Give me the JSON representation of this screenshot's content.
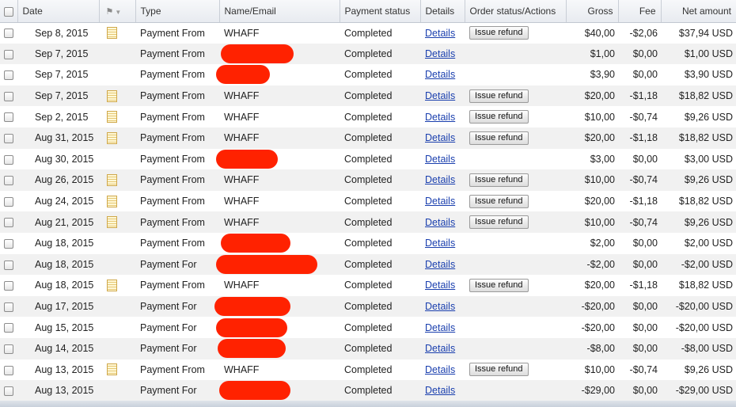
{
  "header": {
    "date": "Date",
    "type": "Type",
    "name_email": "Name/Email",
    "payment_status": "Payment status",
    "details": "Details",
    "order_status": "Order status/Actions",
    "gross": "Gross",
    "fee": "Fee",
    "net": "Net amount",
    "flag_icon": "flag-icon"
  },
  "rows": [
    {
      "date": "Sep 8, 2015",
      "note": true,
      "type": "Payment From",
      "name": "WHAFF",
      "redacted": false,
      "status": "Completed",
      "details": "Details",
      "action": "Issue refund",
      "gross": "$40,00",
      "fee": "-$2,06",
      "net": "$37,94 USD"
    },
    {
      "date": "Sep 7, 2015",
      "note": false,
      "type": "Payment From",
      "name": "",
      "redacted": true,
      "status": "Completed",
      "details": "Details",
      "action": "",
      "gross": "$1,00",
      "fee": "$0,00",
      "net": "$1,00 USD"
    },
    {
      "date": "Sep 7, 2015",
      "note": false,
      "type": "Payment From",
      "name": "",
      "redacted": true,
      "status": "Completed",
      "details": "Details",
      "action": "",
      "gross": "$3,90",
      "fee": "$0,00",
      "net": "$3,90 USD"
    },
    {
      "date": "Sep 7, 2015",
      "note": true,
      "type": "Payment From",
      "name": "WHAFF",
      "redacted": false,
      "status": "Completed",
      "details": "Details",
      "action": "Issue refund",
      "gross": "$20,00",
      "fee": "-$1,18",
      "net": "$18,82 USD"
    },
    {
      "date": "Sep 2, 2015",
      "note": true,
      "type": "Payment From",
      "name": "WHAFF",
      "redacted": false,
      "status": "Completed",
      "details": "Details",
      "action": "Issue refund",
      "gross": "$10,00",
      "fee": "-$0,74",
      "net": "$9,26 USD"
    },
    {
      "date": "Aug 31, 2015",
      "note": true,
      "type": "Payment From",
      "name": "WHAFF",
      "redacted": false,
      "status": "Completed",
      "details": "Details",
      "action": "Issue refund",
      "gross": "$20,00",
      "fee": "-$1,18",
      "net": "$18,82 USD"
    },
    {
      "date": "Aug 30, 2015",
      "note": false,
      "type": "Payment From",
      "name": "",
      "redacted": true,
      "status": "Completed",
      "details": "Details",
      "action": "",
      "gross": "$3,00",
      "fee": "$0,00",
      "net": "$3,00 USD"
    },
    {
      "date": "Aug 26, 2015",
      "note": true,
      "type": "Payment From",
      "name": "WHAFF",
      "redacted": false,
      "status": "Completed",
      "details": "Details",
      "action": "Issue refund",
      "gross": "$10,00",
      "fee": "-$0,74",
      "net": "$9,26 USD"
    },
    {
      "date": "Aug 24, 2015",
      "note": true,
      "type": "Payment From",
      "name": "WHAFF",
      "redacted": false,
      "status": "Completed",
      "details": "Details",
      "action": "Issue refund",
      "gross": "$20,00",
      "fee": "-$1,18",
      "net": "$18,82 USD"
    },
    {
      "date": "Aug 21, 2015",
      "note": true,
      "type": "Payment From",
      "name": "WHAFF",
      "redacted": false,
      "status": "Completed",
      "details": "Details",
      "action": "Issue refund",
      "gross": "$10,00",
      "fee": "-$0,74",
      "net": "$9,26 USD"
    },
    {
      "date": "Aug 18, 2015",
      "note": false,
      "type": "Payment From",
      "name": "",
      "redacted": true,
      "status": "Completed",
      "details": "Details",
      "action": "",
      "gross": "$2,00",
      "fee": "$0,00",
      "net": "$2,00 USD"
    },
    {
      "date": "Aug 18, 2015",
      "note": false,
      "type": "Payment For",
      "name": "",
      "redacted": true,
      "status": "Completed",
      "details": "Details",
      "action": "",
      "gross": "-$2,00",
      "fee": "$0,00",
      "net": "-$2,00 USD"
    },
    {
      "date": "Aug 18, 2015",
      "note": true,
      "type": "Payment From",
      "name": "WHAFF",
      "redacted": false,
      "status": "Completed",
      "details": "Details",
      "action": "Issue refund",
      "gross": "$20,00",
      "fee": "-$1,18",
      "net": "$18,82 USD"
    },
    {
      "date": "Aug 17, 2015",
      "note": false,
      "type": "Payment For",
      "name": "",
      "redacted": true,
      "status": "Completed",
      "details": "Details",
      "action": "",
      "gross": "-$20,00",
      "fee": "$0,00",
      "net": "-$20,00 USD"
    },
    {
      "date": "Aug 15, 2015",
      "note": false,
      "type": "Payment For",
      "name": "",
      "redacted": true,
      "status": "Completed",
      "details": "Details",
      "action": "",
      "gross": "-$20,00",
      "fee": "$0,00",
      "net": "-$20,00 USD"
    },
    {
      "date": "Aug 14, 2015",
      "note": false,
      "type": "Payment For",
      "name": "",
      "redacted": true,
      "status": "Completed",
      "details": "Details",
      "action": "",
      "gross": "-$8,00",
      "fee": "$0,00",
      "net": "-$8,00 USD"
    },
    {
      "date": "Aug 13, 2015",
      "note": true,
      "type": "Payment From",
      "name": "WHAFF",
      "redacted": false,
      "status": "Completed",
      "details": "Details",
      "action": "Issue refund",
      "gross": "$10,00",
      "fee": "-$0,74",
      "net": "$9,26 USD"
    },
    {
      "date": "Aug 13, 2015",
      "note": false,
      "type": "Payment For",
      "name": "",
      "redacted": true,
      "status": "Completed",
      "details": "Details",
      "action": "",
      "gross": "-$29,00",
      "fee": "$0,00",
      "net": "-$29,00 USD"
    }
  ],
  "colors": {
    "redaction": "#ff2200",
    "link": "#1a3fae",
    "alt_row": "#f1f1f1"
  }
}
